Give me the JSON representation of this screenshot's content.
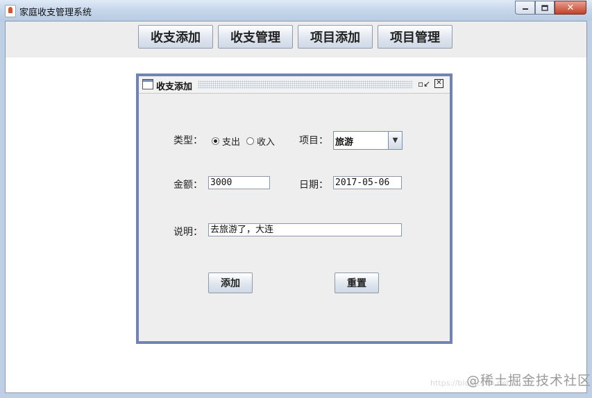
{
  "window": {
    "title": "家庭收支管理系统",
    "close_symbol": "✕"
  },
  "menu": {
    "items": [
      {
        "label": "收支添加"
      },
      {
        "label": "收支管理"
      },
      {
        "label": "项目添加"
      },
      {
        "label": "项目管理"
      }
    ]
  },
  "internal_frame": {
    "title": "收支添加",
    "restore_symbol": "▫↙",
    "close_symbol": "✕"
  },
  "form": {
    "type_label": "类型：",
    "type_options": [
      {
        "label": "支出",
        "selected": true
      },
      {
        "label": "收入",
        "selected": false
      }
    ],
    "project_label": "项目：",
    "project_value": "旅游",
    "amount_label": "金额：",
    "amount_value": "3000",
    "date_label": "日期：",
    "date_value": "2017-05-06",
    "note_label": "说明：",
    "note_value": "去旅游了，大连",
    "add_button": "添加",
    "reset_button": "重置"
  },
  "watermark": {
    "text": "@稀土掘金技术社区",
    "faint_text": "https://blog.csdn.net/..."
  }
}
